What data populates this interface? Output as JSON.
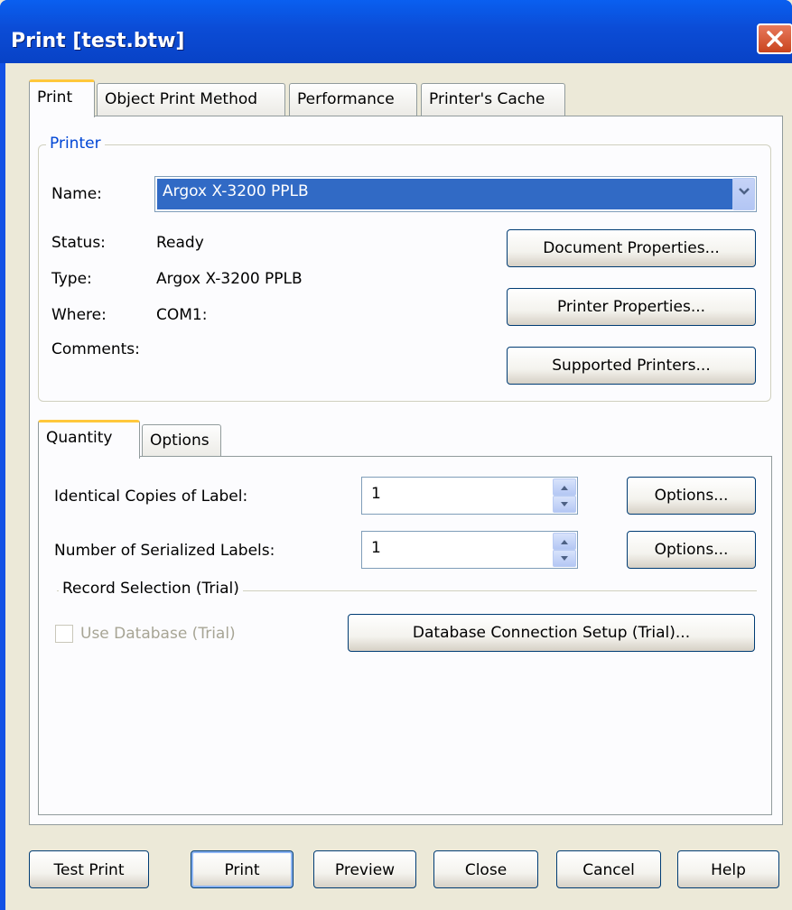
{
  "window": {
    "title": "Print [test.btw]"
  },
  "main_tabs": [
    {
      "label": "Print"
    },
    {
      "label": "Object Print Method"
    },
    {
      "label": "Performance"
    },
    {
      "label": "Printer's Cache"
    }
  ],
  "printer": {
    "group_label": "Printer",
    "name_label": "Name:",
    "name_value": "Argox X-3200 PPLB",
    "status_label": "Status:",
    "status_value": "Ready",
    "type_label": "Type:",
    "type_value": "Argox X-3200 PPLB",
    "where_label": "Where:",
    "where_value": "COM1:",
    "comments_label": "Comments:",
    "document_properties": "Document Properties...",
    "printer_properties": "Printer Properties...",
    "supported_printers": "Supported Printers..."
  },
  "sub_tabs": [
    {
      "label": "Quantity"
    },
    {
      "label": "Options"
    }
  ],
  "quantity": {
    "identical_label": "Identical Copies of Label:",
    "identical_value": "1",
    "identical_options": "Options...",
    "serialized_label": "Number of Serialized Labels:",
    "serialized_value": "1",
    "serialized_options": "Options...",
    "record_selection": "Record Selection  (Trial)",
    "use_database": "Use Database (Trial)",
    "db_setup": "Database Connection Setup (Trial)..."
  },
  "buttons": {
    "test_print": "Test Print",
    "print": "Print",
    "preview": "Preview",
    "close": "Close",
    "cancel": "Cancel",
    "help": "Help"
  },
  "colors": {
    "titlebar": "#0842C6",
    "dialog_bg": "#ECE9D8",
    "selection": "#316AC5",
    "tab_highlight": "#FFC83C",
    "group_label": "#0046D5"
  },
  "icons": [
    "close-icon",
    "chevron-down-icon",
    "spin-up-icon",
    "spin-down-icon"
  ]
}
